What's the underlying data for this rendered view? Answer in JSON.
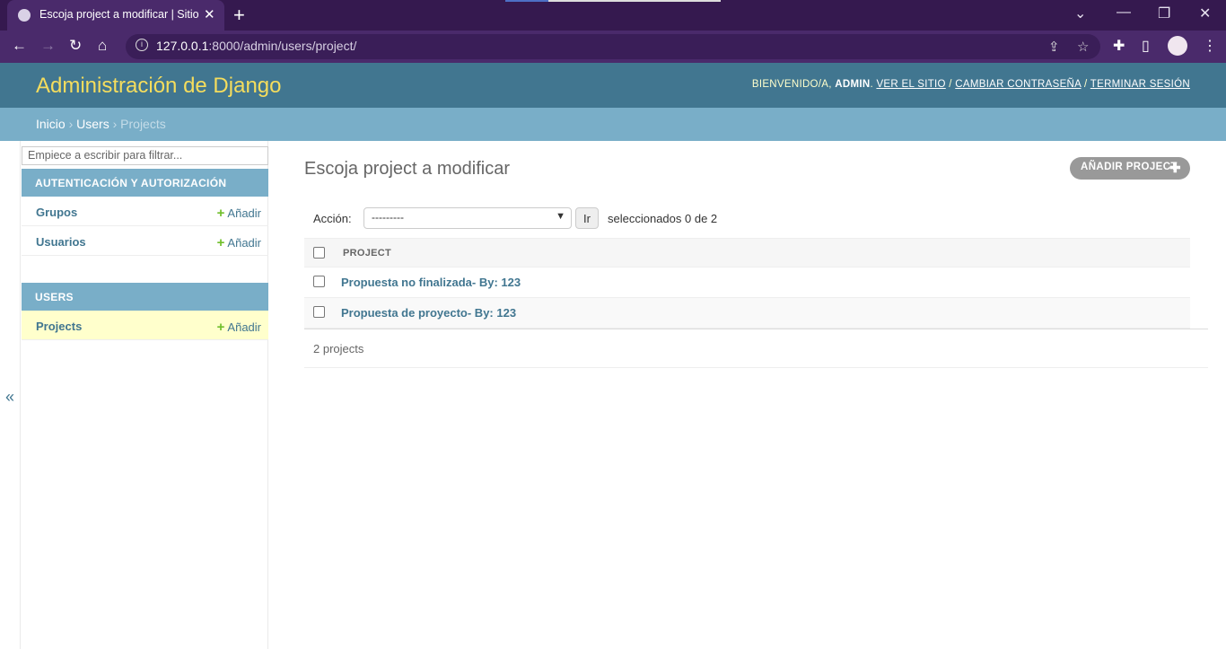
{
  "browser": {
    "tab_title": "Escoja project a modificar | Sitio de",
    "url_host": "127.0.0.1",
    "url_rest": ":8000/admin/users/project/"
  },
  "header": {
    "branding": "Administración de Django",
    "welcome": "BIENVENIDO/A, ",
    "username": "ADMIN",
    "view_site": "VER EL SITIO",
    "change_password": "CAMBIAR CONTRASEÑA",
    "logout": "TERMINAR SESIÓN"
  },
  "breadcrumbs": {
    "home": "Inicio",
    "app": "Users",
    "current": "Projects"
  },
  "sidebar": {
    "filter_placeholder": "Empiece a escribir para filtrar...",
    "toggle": "«",
    "modules": [
      {
        "caption": "AUTENTICACIÓN Y AUTORIZACIÓN",
        "rows": [
          {
            "name": "Grupos",
            "add": "Añadir"
          },
          {
            "name": "Usuarios",
            "add": "Añadir"
          }
        ]
      },
      {
        "caption": "USERS",
        "rows": [
          {
            "name": "Projects",
            "add": "Añadir"
          }
        ]
      }
    ]
  },
  "content": {
    "title": "Escoja project a modificar",
    "add_button": "AÑADIR PROJECT",
    "action_label": "Acción:",
    "action_selected": "---------",
    "go_button": "Ir",
    "counter": "seleccionados 0 de 2",
    "column_header": "PROJECT",
    "rows": [
      "Propuesta no finalizada- By: 123",
      "Propuesta de proyecto- By: 123"
    ],
    "paginator": "2 projects"
  }
}
